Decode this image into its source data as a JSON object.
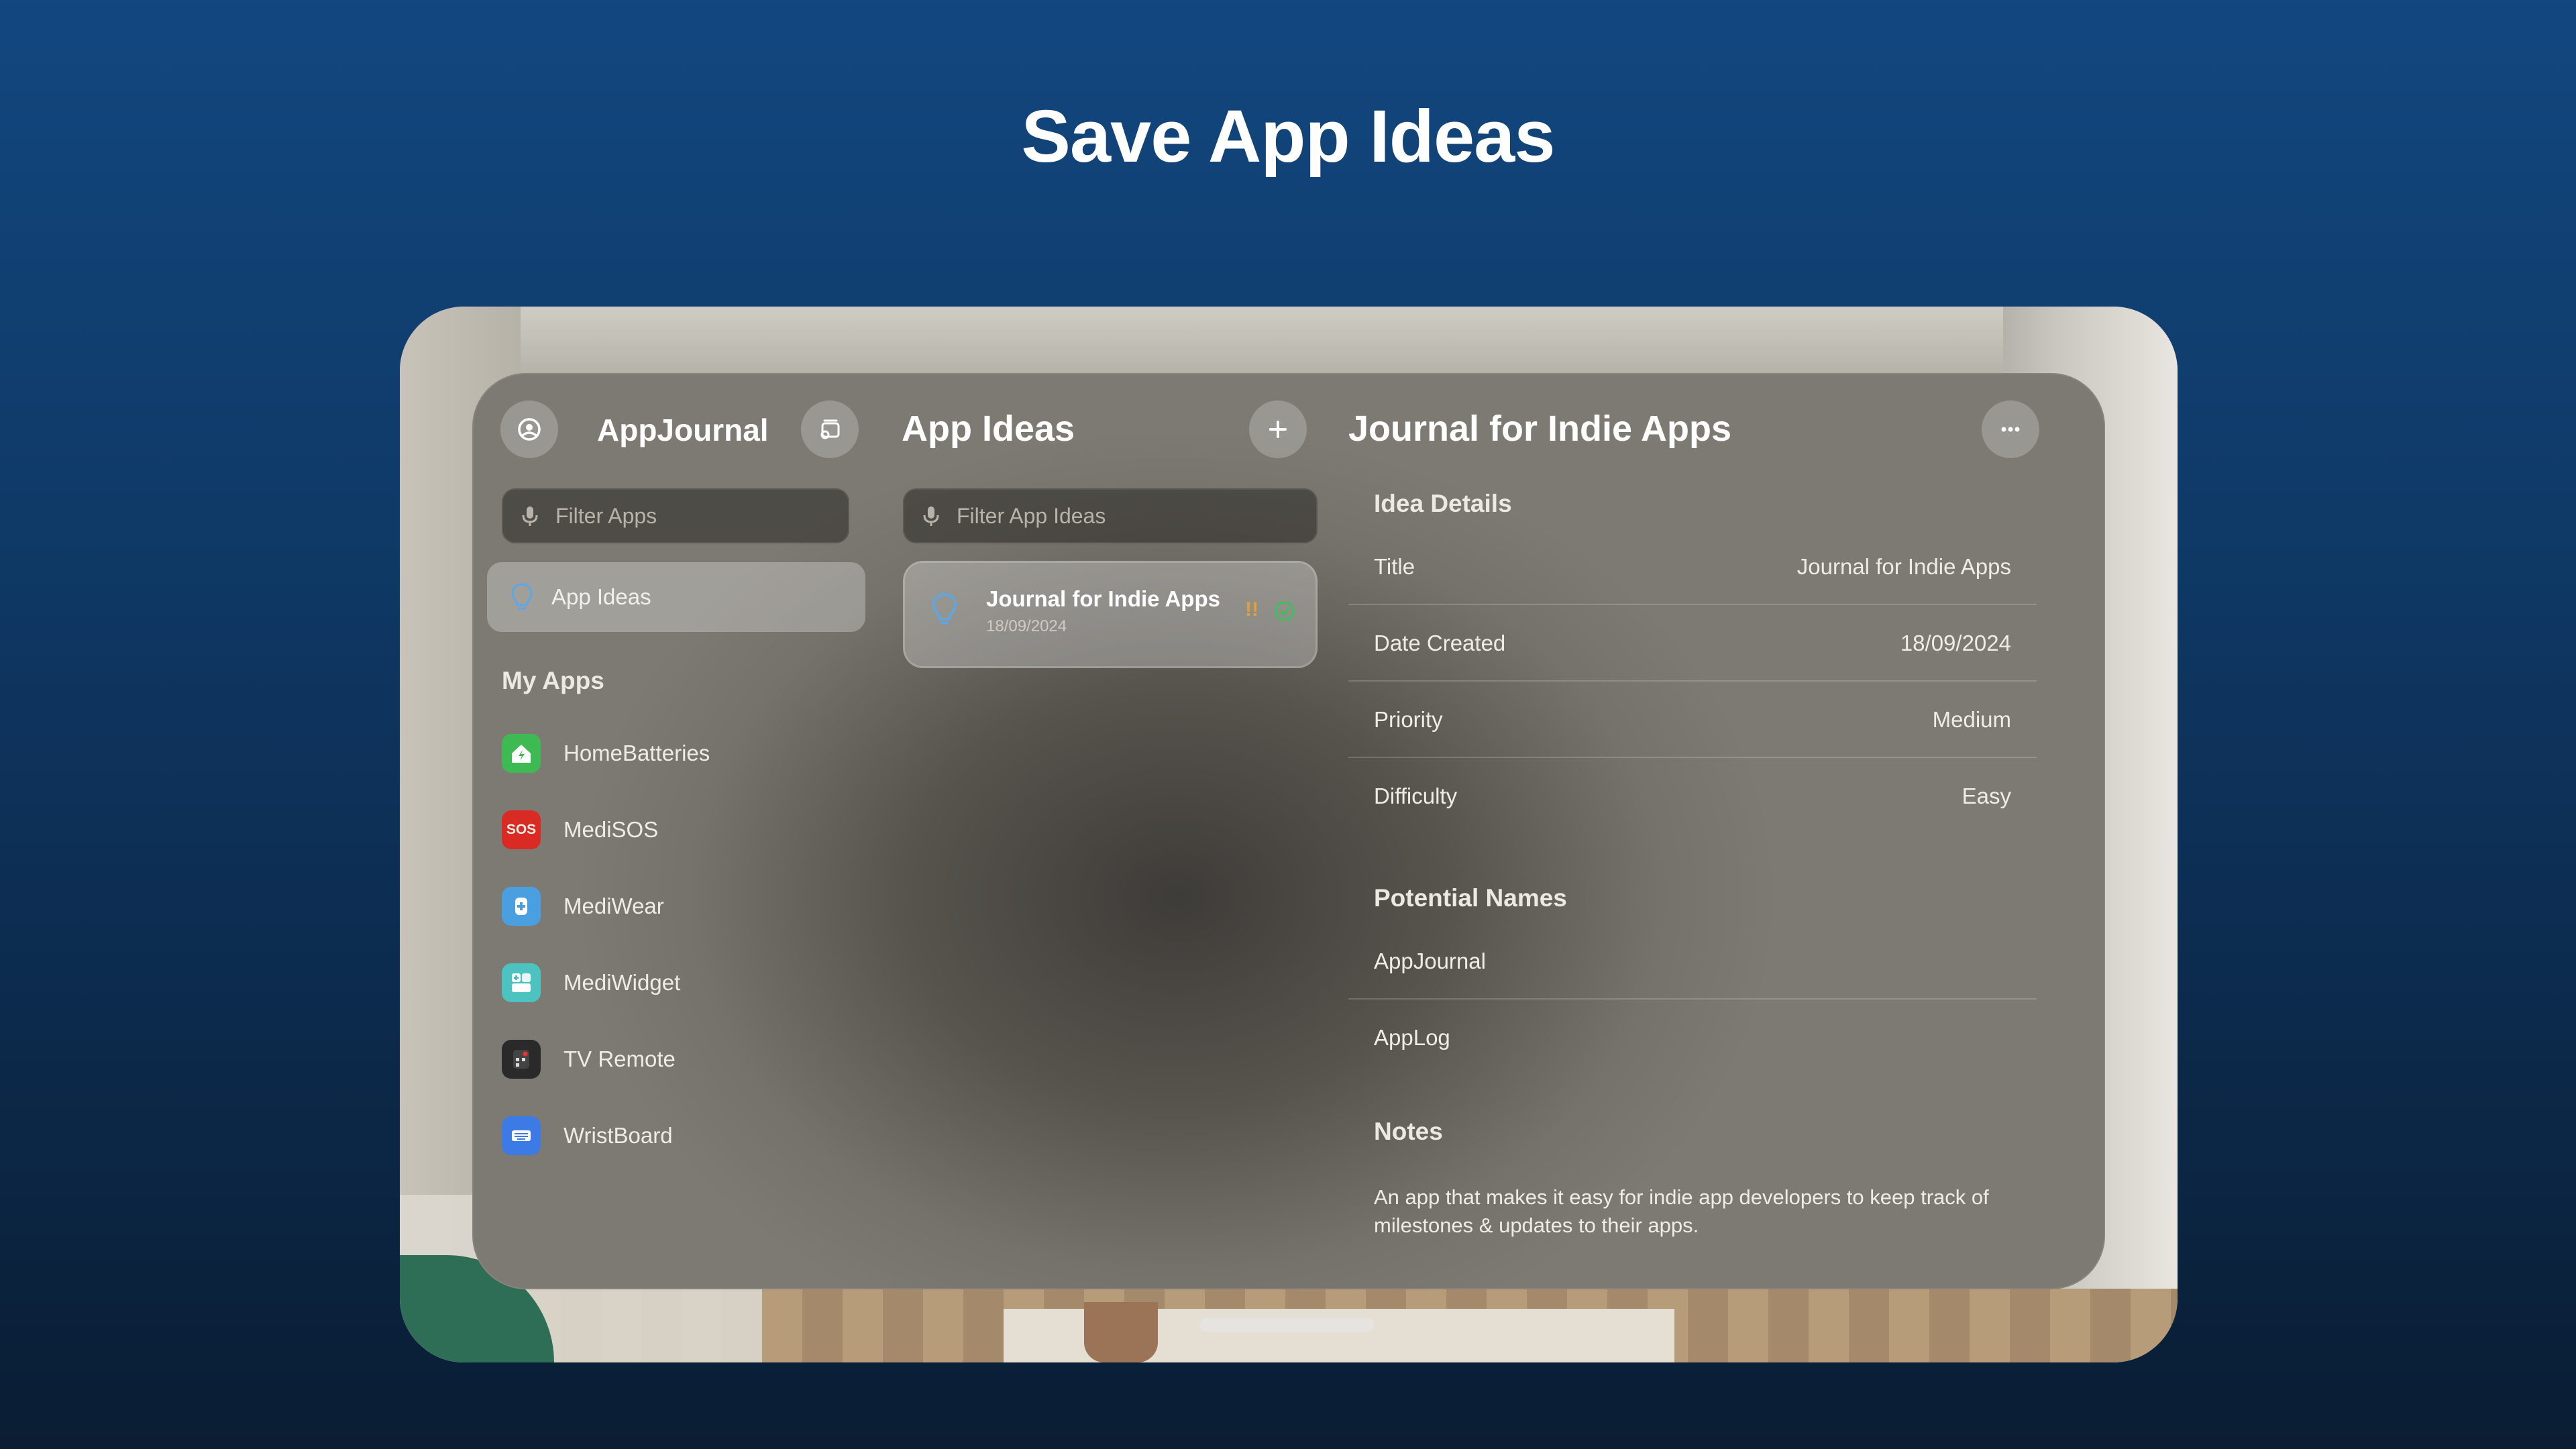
{
  "headline": "Save App Ideas",
  "sidebar": {
    "app_title": "AppJournal",
    "search_placeholder": "Filter Apps",
    "selected_item": "App Ideas",
    "section_title": "My Apps",
    "apps": [
      {
        "label": "HomeBatteries",
        "icon": "home-batteries-app-icon",
        "color": "#3dbb52"
      },
      {
        "label": "MediSOS",
        "icon": "sos-app-icon",
        "color": "#d92b23",
        "icon_text": "SOS"
      },
      {
        "label": "MediWear",
        "icon": "medi-wear-app-icon",
        "color": "#4a9fe0"
      },
      {
        "label": "MediWidget",
        "icon": "medi-widget-app-icon",
        "color": "#4cc3c0"
      },
      {
        "label": "TV Remote",
        "icon": "tv-remote-app-icon",
        "color": "#2a2a2a"
      },
      {
        "label": "WristBoard",
        "icon": "wrist-board-app-icon",
        "color": "#3c7ae6"
      }
    ]
  },
  "ideas_list": {
    "title": "App Ideas",
    "search_placeholder": "Filter App Ideas",
    "items": [
      {
        "title": "Journal for Indie Apps",
        "date": "18/09/2024",
        "priority_mark": "!!"
      }
    ]
  },
  "detail": {
    "title": "Journal for Indie Apps",
    "idea_details_heading": "Idea Details",
    "fields": [
      {
        "label": "Title",
        "value": "Journal for Indie Apps"
      },
      {
        "label": "Date Created",
        "value": "18/09/2024"
      },
      {
        "label": "Priority",
        "value": "Medium"
      },
      {
        "label": "Difficulty",
        "value": "Easy"
      }
    ],
    "potential_names_heading": "Potential Names",
    "potential_names": [
      "AppJournal",
      "AppLog"
    ],
    "notes_heading": "Notes",
    "notes": "An app that makes it easy for indie app developers to keep track of milestones & updates to their apps."
  },
  "colors": {
    "accent_blue": "#5aa8e8",
    "priority_orange": "#e3a03a",
    "complete_green": "#3fbf5a"
  }
}
